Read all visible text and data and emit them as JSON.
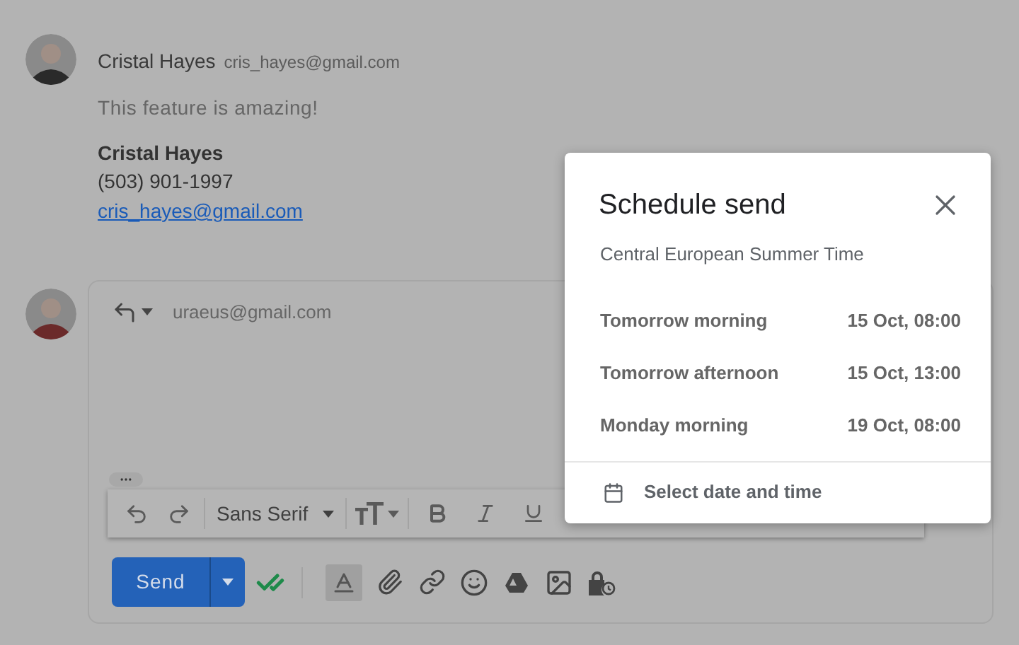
{
  "message": {
    "sender": "Cristal Hayes",
    "email": "cris_hayes@gmail.com",
    "body": "This feature is amazing!",
    "signature": {
      "name": "Cristal Hayes",
      "phone": "(503) 901-1997",
      "email": "cris_hayes@gmail.com"
    }
  },
  "reply": {
    "to": "uraeus@gmail.com",
    "font": "Sans Serif",
    "send": "Send"
  },
  "schedule_dialog": {
    "title": "Schedule send",
    "timezone": "Central European Summer Time",
    "options": [
      {
        "label": "Tomorrow morning",
        "time": "15 Oct, 08:00"
      },
      {
        "label": "Tomorrow afternoon",
        "time": "15 Oct, 13:00"
      },
      {
        "label": "Monday morning",
        "time": "19 Oct, 08:00"
      }
    ],
    "custom": "Select date and time"
  }
}
